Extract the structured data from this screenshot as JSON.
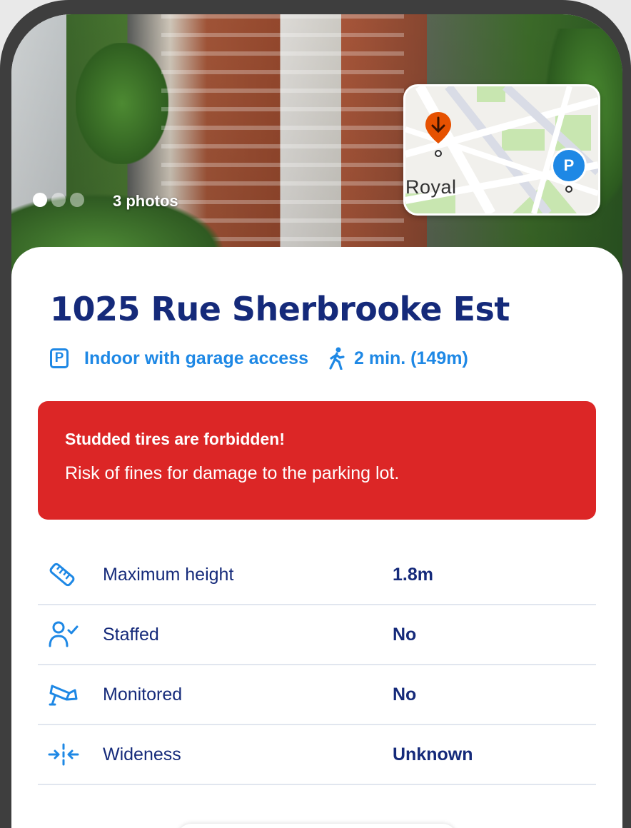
{
  "photos": {
    "count_label": "3 photos",
    "dot_count": 3,
    "active_index": 0
  },
  "map": {
    "street_label": "Royal",
    "parking_marker_label": "P",
    "colors": {
      "destination_pin": "#e65100",
      "parking_pin": "#1e88e5"
    }
  },
  "address": {
    "title": "1025 Rue Sherbrooke Est"
  },
  "meta": {
    "parking_icon_label": "P",
    "parking_type": "Indoor with garage access",
    "walk_time": "2 min. (149m)"
  },
  "alert": {
    "title": "Studded tires are forbidden!",
    "body": "Risk of fines for damage to the parking lot.",
    "color": "#dc2626"
  },
  "details": [
    {
      "icon": "ruler-icon",
      "label": "Maximum height",
      "value": "1.8m"
    },
    {
      "icon": "person-check-icon",
      "label": "Staffed",
      "value": "No"
    },
    {
      "icon": "security-camera-icon",
      "label": "Monitored",
      "value": "No"
    },
    {
      "icon": "width-arrows-icon",
      "label": "Wideness",
      "value": "Unknown"
    }
  ],
  "colors": {
    "navy": "#152a7a",
    "accent": "#1e88e5"
  }
}
